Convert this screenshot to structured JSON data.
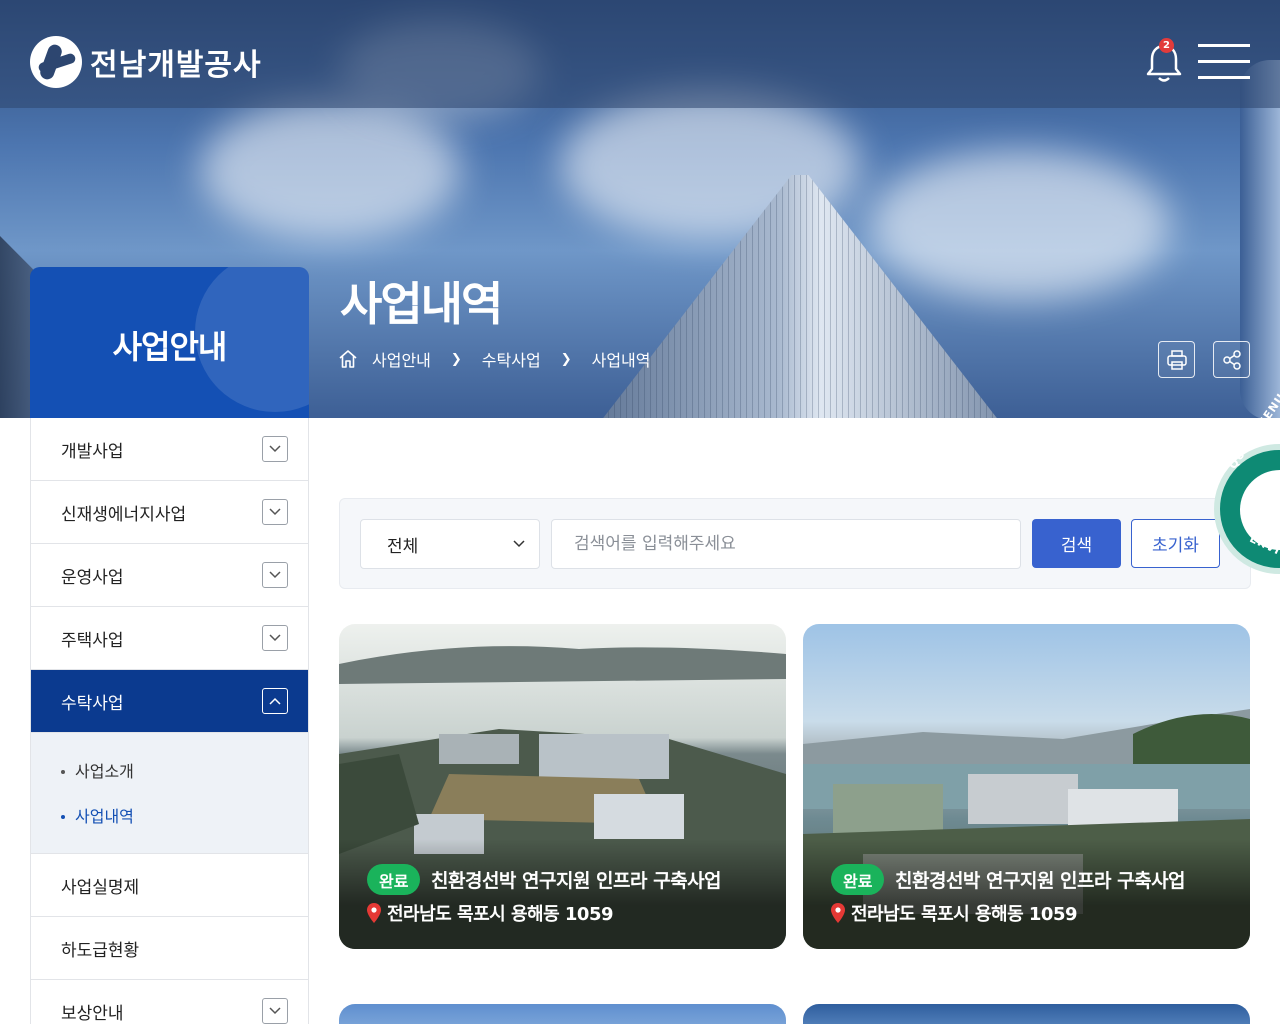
{
  "header": {
    "logo_text": "전남개발공사",
    "notification_count": "2"
  },
  "section": {
    "title": "사업안내"
  },
  "page": {
    "title": "사업내역",
    "breadcrumb": [
      "사업안내",
      "수탁사업",
      "사업내역"
    ]
  },
  "sidebar": {
    "items": [
      {
        "label": "개발사업"
      },
      {
        "label": "신재생에너지사업"
      },
      {
        "label": "운영사업"
      },
      {
        "label": "주택사업"
      },
      {
        "label": "수탁사업"
      },
      {
        "label": "사업실명제"
      },
      {
        "label": "하도급현황"
      },
      {
        "label": "보상안내"
      }
    ],
    "submenu": [
      {
        "label": "사업소개"
      },
      {
        "label": "사업내역"
      }
    ]
  },
  "search": {
    "category_selected": "전체",
    "placeholder": "검색어를 입력해주세요",
    "value": "",
    "search_label": "검색",
    "reset_label": "초기화"
  },
  "quick_menu": {
    "top_text": "QUICK MENU S",
    "bottom_text": "ERVICE"
  },
  "cards": [
    {
      "status": "완료",
      "title": "친환경선박 연구지원 인프라 구축사업",
      "address": "전라남도 목포시 용해동 1059"
    },
    {
      "status": "완료",
      "title": "친환경선박 연구지원 인프라 구축사업",
      "address": "전라남도 목포시 용해동 1059"
    }
  ],
  "colors": {
    "brand_blue": "#1450b4",
    "menu_active": "#0b3a8f",
    "button_blue": "#3862cf",
    "status_green": "#1ab35b"
  }
}
